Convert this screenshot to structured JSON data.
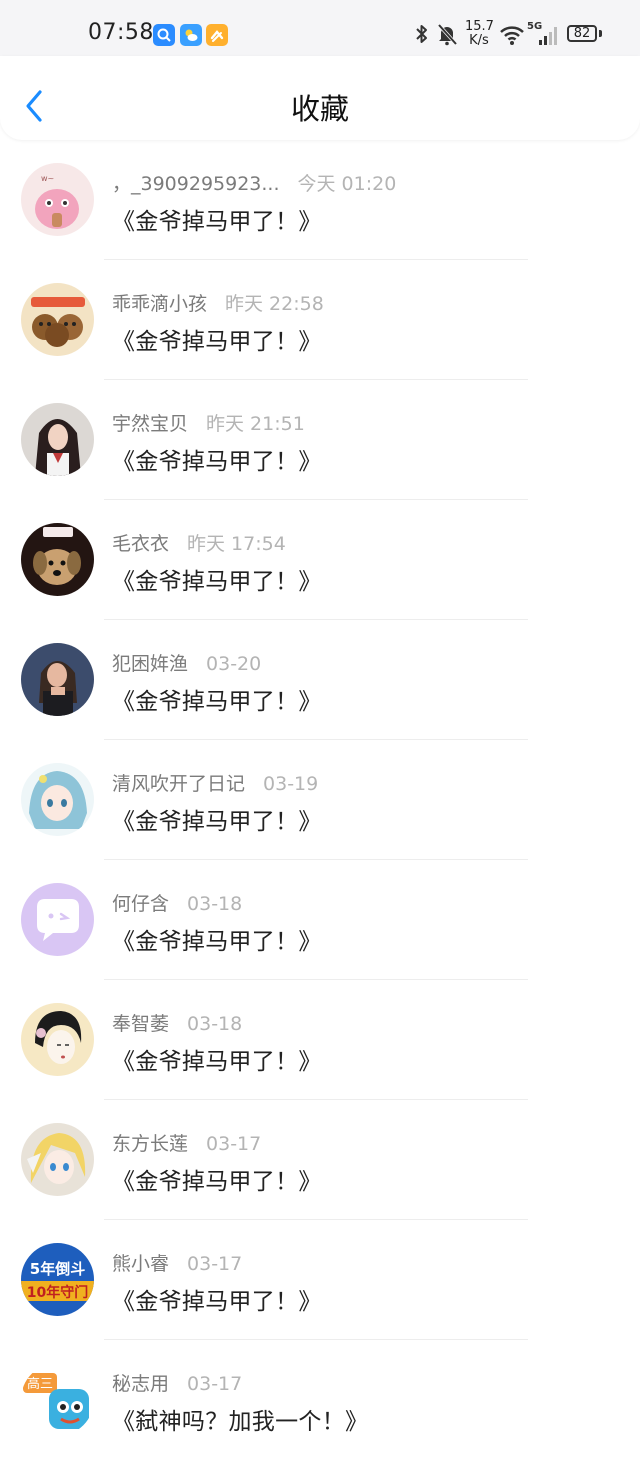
{
  "status_bar": {
    "time": "07:58",
    "net_speed_value": "15.7",
    "net_speed_unit": "K/s",
    "network_type": "5G",
    "battery": "82"
  },
  "header": {
    "title": "收藏"
  },
  "items": [
    {
      "name": "，_3909295923...",
      "time": "今天 01:20",
      "content": "《金爷掉马甲了！》",
      "avatar": "pink-cartoon",
      "colors": [
        "#f6dede",
        "#e98aa8"
      ]
    },
    {
      "name": "乖乖滴小孩",
      "time": "昨天 22:58",
      "content": "《金爷掉马甲了！》",
      "avatar": "bears",
      "colors": [
        "#f3e2c2",
        "#8a5a2b"
      ]
    },
    {
      "name": "宇然宝贝",
      "time": "昨天 21:51",
      "content": "《金爷掉马甲了！》",
      "avatar": "girl-portrait",
      "colors": [
        "#d8d4d0",
        "#2b2020"
      ]
    },
    {
      "name": "毛衣衣",
      "time": "昨天 17:54",
      "content": "《金爷掉马甲了！》",
      "avatar": "puppy",
      "colors": [
        "#2a1a16",
        "#c8a070"
      ]
    },
    {
      "name": "犯困姩渔",
      "time": "03-20",
      "content": "《金爷掉马甲了！》",
      "avatar": "woman-dark",
      "colors": [
        "#3a4a6a",
        "#c89a80"
      ]
    },
    {
      "name": "清风吹开了日记",
      "time": "03-19",
      "content": "《金爷掉马甲了！》",
      "avatar": "anime-blue",
      "colors": [
        "#dff0f6",
        "#7ab8d0"
      ]
    },
    {
      "name": "何仔含",
      "time": "03-18",
      "content": "《金爷掉马甲了！》",
      "avatar": "chat-bubble",
      "colors": [
        "#d8c4f3",
        "#ffffff"
      ]
    },
    {
      "name": "奉智萎",
      "time": "03-18",
      "content": "《金爷掉马甲了！》",
      "avatar": "ink-girl",
      "colors": [
        "#f5e6c0",
        "#222222"
      ]
    },
    {
      "name": "东方长莲",
      "time": "03-17",
      "content": "《金爷掉马甲了！》",
      "avatar": "anime-blonde",
      "colors": [
        "#e6e0d6",
        "#f0d060"
      ]
    },
    {
      "name": "熊小睿",
      "time": "03-17",
      "content": "《金爷掉马甲了！》",
      "avatar": "text-badge",
      "colors": [
        "#1f5fbf",
        "#f0b020"
      ]
    },
    {
      "name": "秘志用",
      "time": "03-17",
      "content": "《弑神吗？加我一个！》",
      "avatar": "orange-cartoon",
      "colors": [
        "#f4a040",
        "#3ab0e0"
      ]
    }
  ],
  "avatar_text": {
    "badge_line1": "5年倒斗",
    "badge_line2": "10年守门",
    "tag_gaosan": "高三"
  }
}
